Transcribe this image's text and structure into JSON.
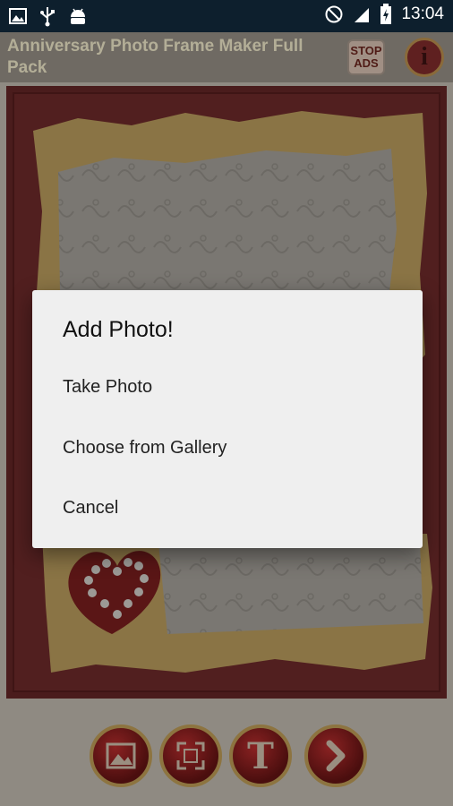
{
  "status_bar": {
    "time": "13:04",
    "left_icons": [
      "image-icon",
      "usb-icon",
      "android-debug-icon"
    ],
    "right_icons": [
      "do-not-disturb-icon",
      "signal-icon",
      "battery-charging-icon"
    ]
  },
  "app_bar": {
    "title": "Anniversary Photo Frame Maker Full Pack",
    "stop_ads_line1": "STOP",
    "stop_ads_line2": "ADS",
    "info_label": "i"
  },
  "dialog": {
    "title": "Add Photo!",
    "options": [
      "Take Photo",
      "Choose from Gallery",
      "Cancel"
    ]
  },
  "toolbar": {
    "buttons": [
      "gallery-icon",
      "fit-frame-icon",
      "text-icon",
      "next-arrow-icon"
    ],
    "text_button_label": "T"
  },
  "colors": {
    "status_bar": "#0d1f2d",
    "dialog_bg": "#efefef",
    "frame_red": "#4f1e1e",
    "frame_gold": "#8a7445",
    "button_red": "#6a1515"
  }
}
